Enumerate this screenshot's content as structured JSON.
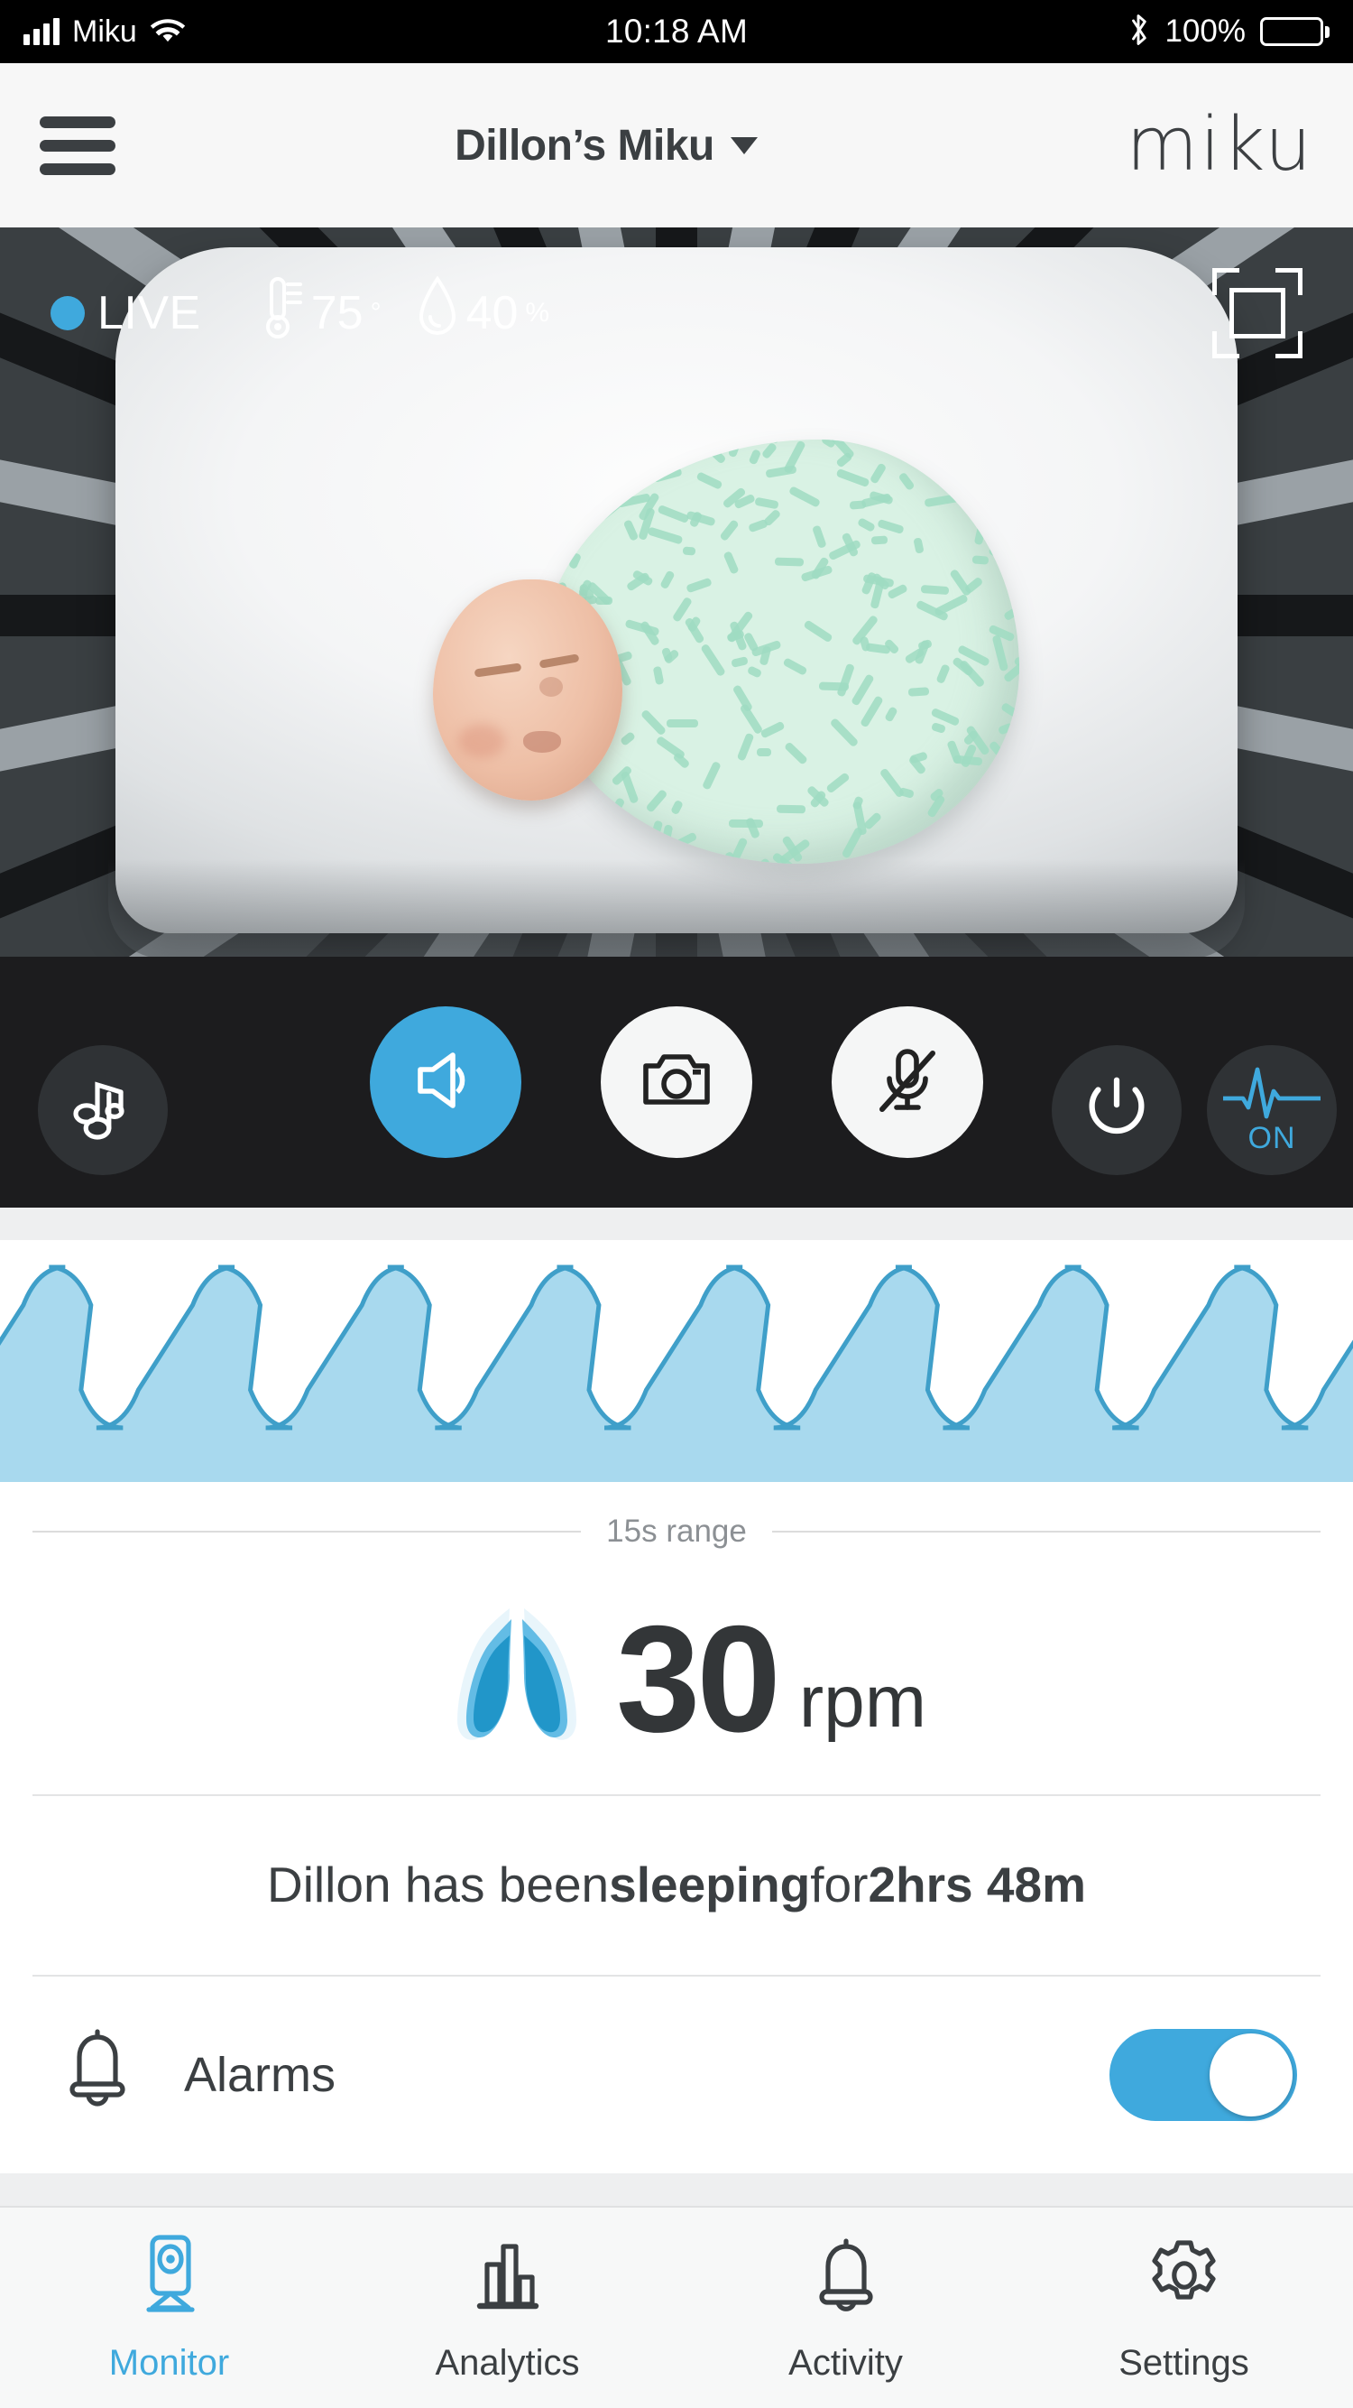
{
  "status_bar": {
    "carrier": "Miku",
    "time": "10:18 AM",
    "battery_percent": "100%",
    "icons": [
      "signal-bars-icon",
      "wifi-icon",
      "bluetooth-icon",
      "battery-icon"
    ]
  },
  "header": {
    "menu_icon": "hamburger-menu-icon",
    "device_title": "Dillon’s Miku",
    "caret_icon": "chevron-down-icon",
    "brand": "miku"
  },
  "video": {
    "live_label": "LIVE",
    "live_dot_color": "#3fa9dd",
    "temperature": "75",
    "temperature_unit": "°",
    "temperature_icon": "thermometer-icon",
    "humidity": "40",
    "humidity_unit": "%",
    "humidity_icon": "water-drop-icon",
    "fullscreen_icon": "fullscreen-expand-icon",
    "music_icon": "music-notes-icon",
    "power_icon": "power-icon",
    "vitals_icon": "pulse-waveform-icon",
    "vitals_state": "ON",
    "controls": [
      {
        "name": "speaker-button",
        "icon": "speaker-icon",
        "active": true
      },
      {
        "name": "camera-button",
        "icon": "camera-icon",
        "active": false
      },
      {
        "name": "mic-mute-button",
        "icon": "microphone-muted-icon",
        "active": false
      }
    ]
  },
  "breathing": {
    "range_label": "15s range",
    "rpm_value": "30",
    "rpm_unit": "rpm",
    "lungs_icon": "lungs-icon",
    "wave_color_fill": "#a8d9ee",
    "wave_color_stroke": "#3f9fc9"
  },
  "chart_data": {
    "type": "area",
    "title": "Breathing waveform",
    "subtitle": "15s range",
    "xlabel": "",
    "ylabel": "",
    "ylim": [
      0,
      1
    ],
    "grid": false,
    "legend": "none",
    "series": [
      {
        "name": "breaths",
        "description": "Square-wave respiration trace, 9 full breath cycles across the 15 second window",
        "cycles": 9,
        "high_level": 1.0,
        "low_level": 0.28,
        "duty_cycle": 0.45,
        "values": [
          0.28,
          1,
          1,
          0.28,
          0.28,
          1,
          1,
          0.28,
          0.28,
          1,
          1,
          0.28,
          0.28,
          1,
          1,
          0.28,
          0.28,
          1,
          1,
          0.28,
          0.28,
          1,
          1,
          0.28,
          0.28,
          1,
          1,
          0.28,
          0.28,
          1,
          1,
          0.28,
          0.28,
          1,
          1,
          0.28
        ]
      }
    ]
  },
  "sleep_status": {
    "prefix": "Dillon has been ",
    "state": "sleeping",
    "middle": " for ",
    "duration": "2hrs 48m"
  },
  "alarms": {
    "icon": "bell-icon",
    "label": "Alarms",
    "enabled": true,
    "on_color": "#3fa9dd"
  },
  "tabs": [
    {
      "label": "Monitor",
      "icon": "camera-device-icon",
      "active": true
    },
    {
      "label": "Analytics",
      "icon": "bar-chart-icon",
      "active": false
    },
    {
      "label": "Activity",
      "icon": "bell-icon",
      "active": false
    },
    {
      "label": "Settings",
      "icon": "gear-icon",
      "active": false
    }
  ]
}
